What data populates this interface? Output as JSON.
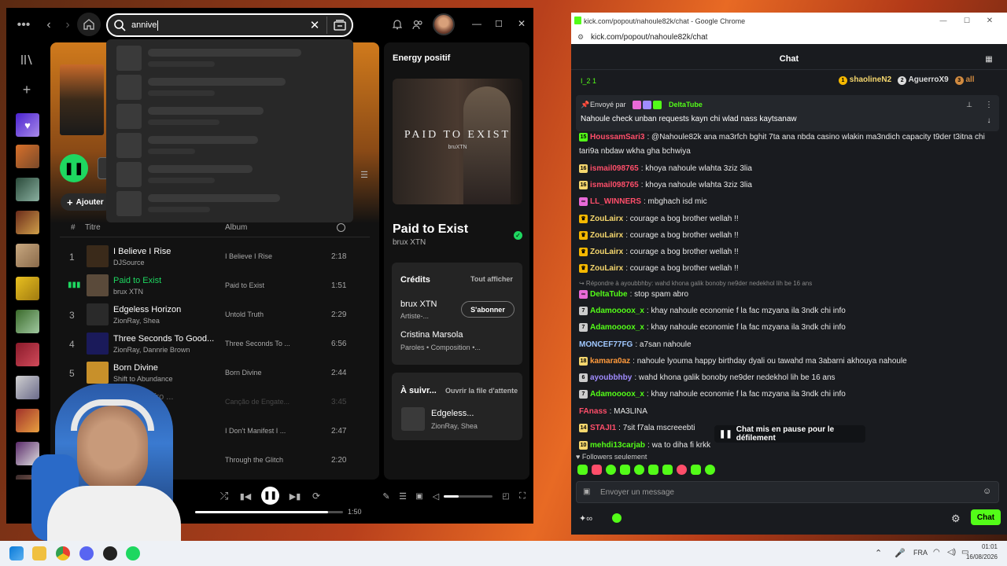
{
  "spotify": {
    "search_value": "annive",
    "hero_right_title": "Energy positif",
    "add_label": "Ajouter",
    "col_title": "Titre",
    "col_album": "Album",
    "col_hash": "#",
    "tracks": [
      {
        "num": "1",
        "title": "I Believe I Rise",
        "artist": "DJSource",
        "album": "I Believe I Rise",
        "dur": "2:18",
        "art": "#3a2a1a",
        "playing": false
      },
      {
        "num": "",
        "title": "Paid to Exist",
        "artist": "brux XTN",
        "album": "Paid to Exist",
        "dur": "1:51",
        "art": "#5a4a3a",
        "playing": true
      },
      {
        "num": "3",
        "title": "Edgeless Horizon",
        "artist": "ZionRay, Shea",
        "album": "Untold Truth",
        "dur": "2:29",
        "art": "#2a2a2a",
        "playing": false
      },
      {
        "num": "4",
        "title": "Three Seconds To Good...",
        "artist": "ZionRay, Dannrie Brown",
        "album": "Three Seconds To ...",
        "dur": "6:56",
        "art": "#1a1a5a",
        "playing": false
      },
      {
        "num": "5",
        "title": "Born Divine",
        "artist": "Shift to Abundance",
        "album": "Born Divine",
        "dur": "2:44",
        "art": "#c8902a",
        "playing": false
      },
      {
        "num": "6",
        "title": "Engate - Afro ...",
        "artist": "",
        "album": "Canção de Engate...",
        "dur": "3:45",
        "art": "#333",
        "playing": false
      },
      {
        "num": "",
        "title": "st I Decide",
        "artist": "",
        "album": "I Don't Manifest I ...",
        "dur": "2:47",
        "art": "#333",
        "playing": false
      },
      {
        "num": "",
        "title": "",
        "artist": "",
        "album": "Through the Glitch",
        "dur": "2:20",
        "art": "#333",
        "playing": false
      }
    ],
    "np_cover_text": "PAID TO EXIST",
    "np_cover_sub": "bruXTN",
    "np_title": "Paid to Exist",
    "np_artist": "brux XTN",
    "credits_title": "Crédits",
    "credits_all": "Tout afficher",
    "credit1_name": "brux XTN",
    "credit1_role": "Artiste-...",
    "subscribe": "S'abonner",
    "credit2_name": "Cristina Marsola",
    "credit2_role": "Paroles • Composition •...",
    "next_title": "À suivr...",
    "next_queue": "Ouvrir la file d'attente",
    "next_song": "Edgeless...",
    "next_artist": "ZionRay, Shea",
    "progress_time": "1:50",
    "progress": 0.9,
    "volume": 0.3,
    "accent": "#1ed760"
  },
  "chrome": {
    "window_title": "kick.com/popout/nahoule82k/chat - Google Chrome",
    "url": "kick.com/popout/nahoule82k/chat"
  },
  "kick": {
    "header": "Chat",
    "leader_left": "I_2 1",
    "leaders": [
      {
        "rank": "1",
        "name": "shaolineN2"
      },
      {
        "rank": "2",
        "name": "AguerroX9"
      },
      {
        "rank": "3",
        "name": "all"
      }
    ],
    "pinned_by_label": "Envoyé par",
    "pinned_by": "DeltaTube",
    "pinned_text": "Nahoule check unban requests kayn chi wlad nass kaytsanaw",
    "messages": [
      {
        "badge": "15",
        "bcolor": "#53fc18",
        "user": "HoussamSari3",
        "ucolor": "#ff4e6a",
        "text": ": @Nahoule82k ana ma3rfch bghit 7ta ana nbda casino wlakin ma3ndich capacity t9der t3itna chi"
      },
      {
        "badge": "",
        "bcolor": "",
        "user": "",
        "ucolor": "#fff",
        "text": "tari9a nbdaw wkha gha bchwiya"
      },
      {
        "badge": "16",
        "bcolor": "#f5d76e",
        "user": "ismail098765",
        "ucolor": "#ff4e6a",
        "text": ": khoya nahoule wlahta 3ziz 3lia"
      },
      {
        "badge": "16",
        "bcolor": "#f5d76e",
        "user": "ismail098765",
        "ucolor": "#ff4e6a",
        "text": ": khoya nahoule wlahta 3ziz 3lia"
      },
      {
        "badge": "∞",
        "bcolor": "#e86ad8",
        "user": "LL_WINNERS",
        "ucolor": "#ff4e6a",
        "text": ": mbghach isd mic"
      },
      {
        "badge": "♛",
        "bcolor": "#f5b800",
        "user": "ZouLairx",
        "ucolor": "#f5d76e",
        "text": ": courage a bog brother wellah !!"
      },
      {
        "badge": "♛",
        "bcolor": "#f5b800",
        "user": "ZouLairx",
        "ucolor": "#f5d76e",
        "text": ": courage a bog brother wellah !!"
      },
      {
        "badge": "♛",
        "bcolor": "#f5b800",
        "user": "ZouLairx",
        "ucolor": "#f5d76e",
        "text": ": courage a bog brother wellah !!"
      },
      {
        "badge": "♛",
        "bcolor": "#f5b800",
        "user": "ZouLairx",
        "ucolor": "#f5d76e",
        "text": ": courage a bog brother wellah !!"
      },
      {
        "badge": "",
        "bcolor": "",
        "user": "",
        "ucolor": "#888",
        "text": "↪ Répondre à ayoubbhby: wahd khona galik bonoby ne9der nedekhol lih be 16 ans"
      },
      {
        "badge": "∞",
        "bcolor": "#e86ad8",
        "user": "DeltaTube",
        "ucolor": "#53fc18",
        "text": ": stop spam abro"
      },
      {
        "badge": "7",
        "bcolor": "#ccc",
        "user": "Adamoooox_x",
        "ucolor": "#53fc18",
        "text": ": khay nahoule economie f la fac mzyana ila 3ndk chi info"
      },
      {
        "badge": "7",
        "bcolor": "#ccc",
        "user": "Adamoooox_x",
        "ucolor": "#53fc18",
        "text": ": khay nahoule economie f la fac mzyana ila 3ndk chi info"
      },
      {
        "badge": "",
        "bcolor": "",
        "user": "MONCEF77FG",
        "ucolor": "#a0c8ff",
        "text": ": a7san nahoule"
      },
      {
        "badge": "18",
        "bcolor": "#f5d76e",
        "user": "kamara0az",
        "ucolor": "#ff9a3c",
        "text": ": nahoule lyouma happy birthday dyali ou tawahd ma 3abarni akhouya nahoule"
      },
      {
        "badge": "6",
        "bcolor": "#ccc",
        "user": "ayoubbhby",
        "ucolor": "#a08cff",
        "text": ": wahd khona galik bonoby ne9der nedekhol lih be 16 ans"
      },
      {
        "badge": "7",
        "bcolor": "#ccc",
        "user": "Adamoooox_x",
        "ucolor": "#53fc18",
        "text": ": khay nahoule economie f la fac mzyana ila 3ndk chi info"
      },
      {
        "badge": "",
        "bcolor": "",
        "user": "FAnass",
        "ucolor": "#ff4e6a",
        "text": ": MA3LINA"
      },
      {
        "badge": "14",
        "bcolor": "#f5d76e",
        "user": "STAJI1",
        "ucolor": "#ff4e6a",
        "text": ": 7sit f7ala mscreeebti"
      },
      {
        "badge": "10",
        "bcolor": "#f5d76e",
        "user": "mehdi13carjab",
        "ucolor": "#53fc18",
        "text": ": wa to diha fi krkk"
      }
    ],
    "paused_label": "Chat mis en pause pour le défilement",
    "followers_only": "Followers seulement",
    "input_placeholder": "Envoyer un message",
    "chat_button": "Chat",
    "accent": "#53fc18"
  },
  "taskbar": {
    "lang": "FRA",
    "time": "01:01",
    "date": "16/08/2026"
  }
}
